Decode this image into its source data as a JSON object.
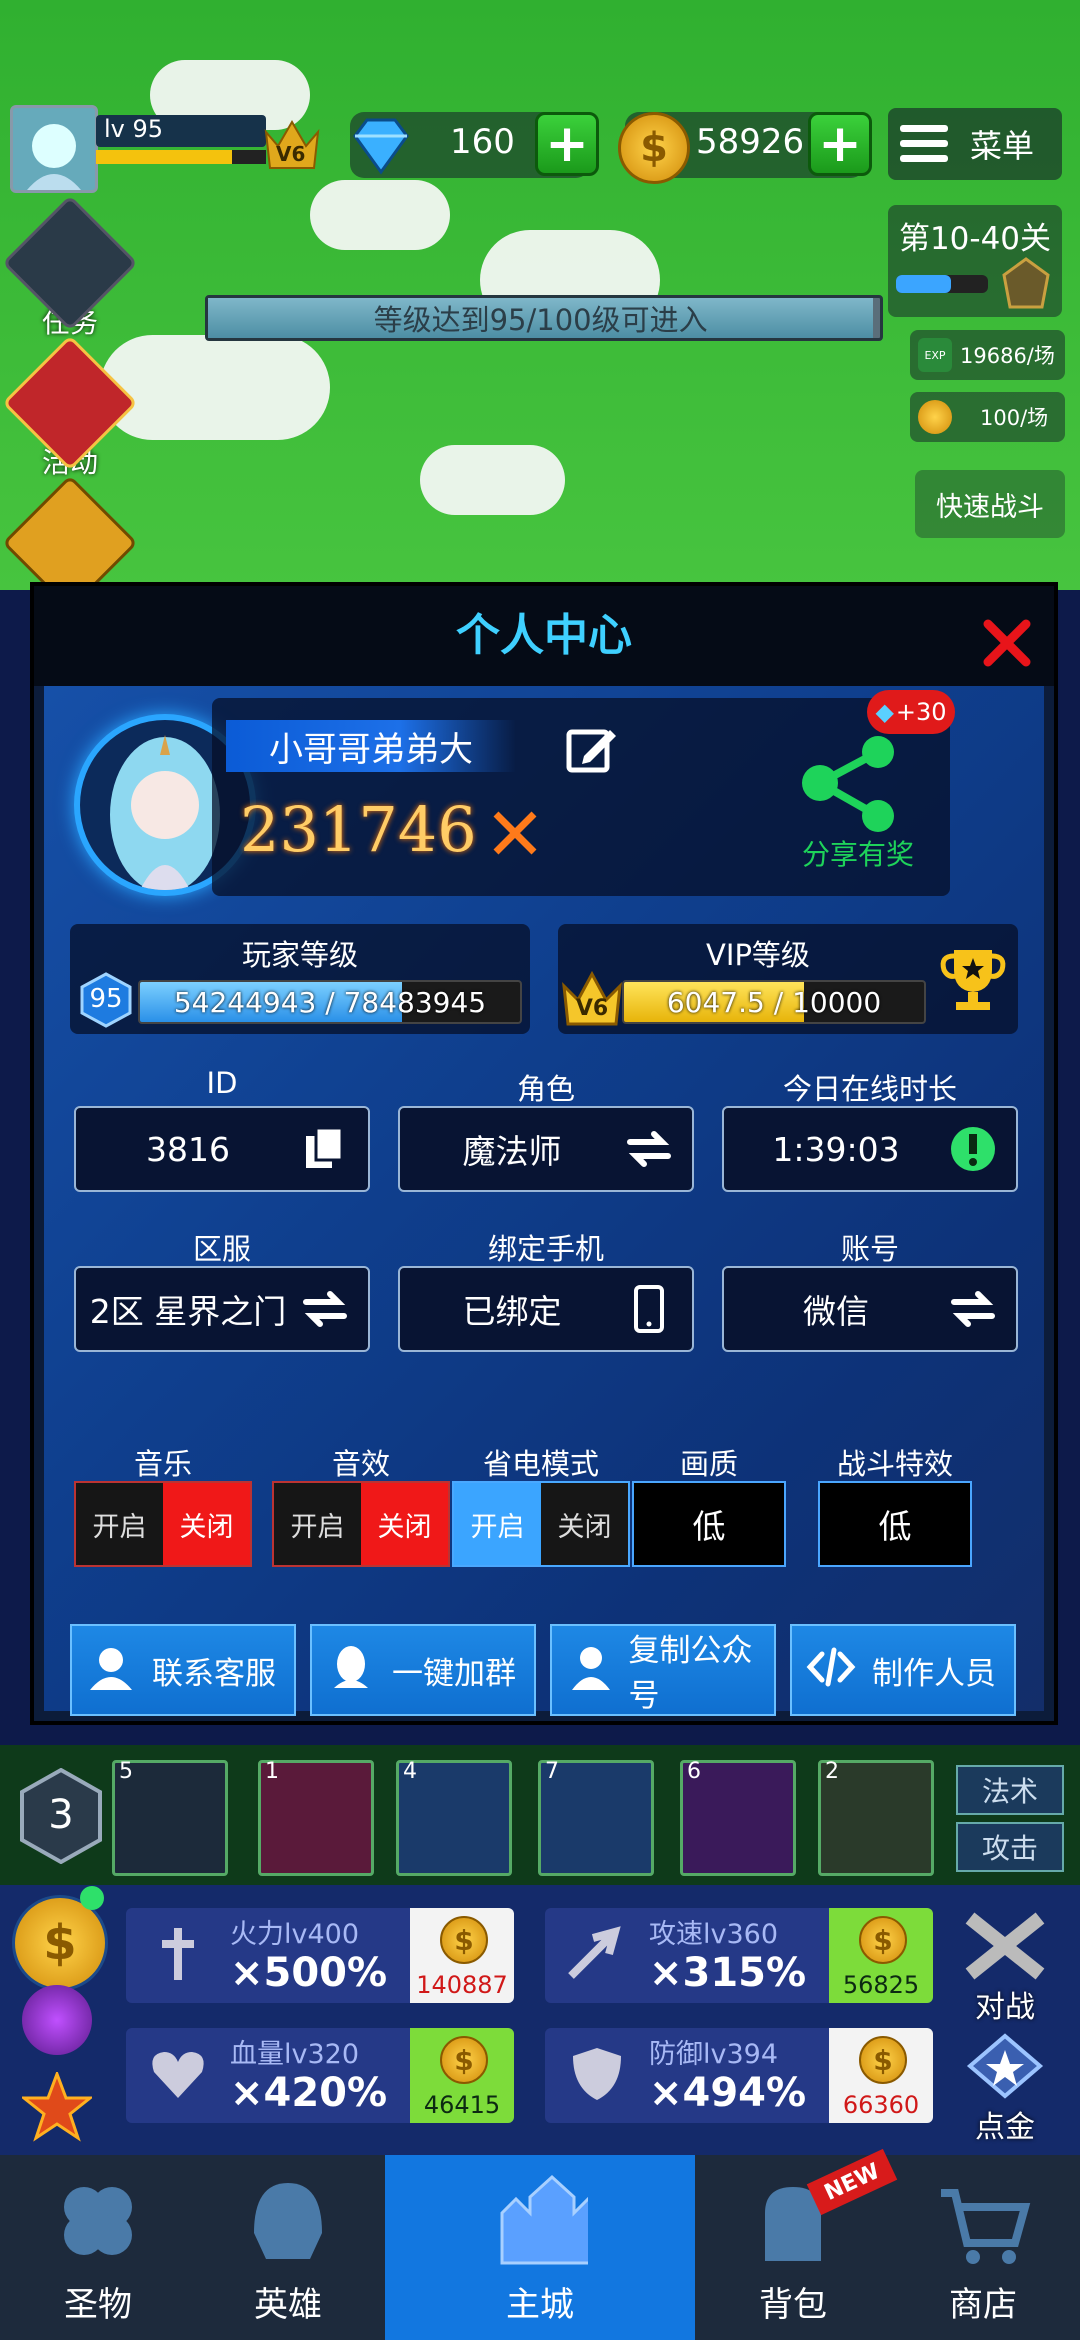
{
  "top": {
    "level": "lv 95",
    "vip": "V6",
    "gems": "160",
    "coins": "58926",
    "menu_label": "菜单",
    "stage": "第10-40关",
    "exp_rate": "19686/场",
    "coin_rate": "100/场",
    "fast_battle": "快速战斗",
    "level_notice": "等级达到95/100级可进入",
    "exp_badge": "EXP"
  },
  "side": {
    "task": "任务",
    "activity": "活动"
  },
  "modal": {
    "title": "个人中心",
    "nickname": "小哥哥弟弟大",
    "power": "231746",
    "share_label": "分享有奖",
    "share_bonus": "+30",
    "player_level_label": "玩家等级",
    "player_level": "95",
    "player_exp_text": "54244943 / 78483945",
    "player_exp_fraction": 0.69,
    "vip_label": "VIP等级",
    "vip_badge": "V6",
    "vip_exp_text": "6047.5 / 10000",
    "vip_fraction": 0.6,
    "id_label": "ID",
    "id_value": "3816",
    "role_label": "角色",
    "role_value": "魔法师",
    "online_label": "今日在线时长",
    "online_value": "1:39:03",
    "server_label": "区服",
    "server_value": "2区 星界之门",
    "phone_label": "绑定手机",
    "phone_value": "已绑定",
    "account_label": "账号",
    "account_value": "微信",
    "music_label": "音乐",
    "sfx_label": "音效",
    "power_save_label": "省电模式",
    "quality_label": "画质",
    "battle_fx_label": "战斗特效",
    "on": "开启",
    "off": "关闭",
    "quality_value": "低",
    "battle_fx_value": "低",
    "btn_service": "联系客服",
    "btn_group": "一键加群",
    "btn_official": "复制公众号",
    "btn_credits": "制作人员"
  },
  "skills": {
    "count": "3",
    "levels": [
      "5",
      "1",
      "4",
      "7",
      "6",
      "2"
    ],
    "magic": "法术",
    "attack": "攻击"
  },
  "upgrades": [
    {
      "name": "火力lv400",
      "mult": "×500%",
      "cost": "140887"
    },
    {
      "name": "攻速lv360",
      "mult": "×315%",
      "cost": "56825"
    },
    {
      "name": "血量lv320",
      "mult": "×420%",
      "cost": "46415"
    },
    {
      "name": "防御lv394",
      "mult": "×494%",
      "cost": "66360"
    }
  ],
  "right_actions": {
    "battle": "对战",
    "gold": "点金"
  },
  "tabs": [
    "圣物",
    "英雄",
    "主城",
    "背包",
    "商店"
  ],
  "new_badge": "NEW",
  "colors": {
    "accent_blue": "#3ba5ff",
    "toggle_red": "#f01818",
    "title_blue": "#3fd0ff",
    "power_gold": "#ffcc66"
  }
}
